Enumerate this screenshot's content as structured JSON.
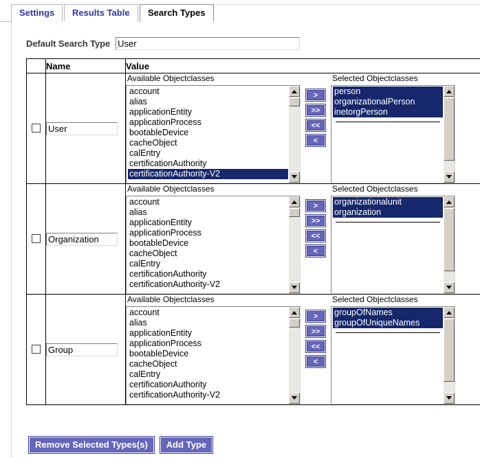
{
  "tabs": [
    {
      "label": "Settings",
      "active": false
    },
    {
      "label": "Results Table",
      "active": false
    },
    {
      "label": "Search Types",
      "active": true
    }
  ],
  "default_search_type": {
    "label": "Default Search Type",
    "value": "User",
    "placeholder": ""
  },
  "table": {
    "headers": [
      "",
      "Name",
      "Value"
    ],
    "header_check": "",
    "header_name": "Name",
    "header_value": "Value"
  },
  "labels": {
    "available": "Available Objectclasses",
    "selected": "Selected Objectclasses"
  },
  "arrow_buttons": [
    {
      "label": ">",
      "name": "move-right-button"
    },
    {
      "label": ">>",
      "name": "move-all-right-button"
    },
    {
      "label": "<<",
      "name": "move-all-left-button"
    },
    {
      "label": "<",
      "name": "move-left-button"
    }
  ],
  "available_objectclasses": [
    "account",
    "alias",
    "applicationEntity",
    "applicationProcess",
    "bootableDevice",
    "cacheObject",
    "calEntry",
    "certificationAuthority",
    "certificationAuthority-V2"
  ],
  "rows": [
    {
      "checked": false,
      "name": "User",
      "available_selected_index": 8,
      "selected_objectclasses": [
        "person",
        "organizationalPerson",
        "inetorgPerson"
      ]
    },
    {
      "checked": false,
      "name": "Organization",
      "available_selected_index": -1,
      "selected_objectclasses": [
        "organizationalunit",
        "organization"
      ]
    },
    {
      "checked": false,
      "name": "Group",
      "available_selected_index": -1,
      "selected_objectclasses": [
        "groupOfNames",
        "groupOfUniqueNames"
      ]
    }
  ],
  "footer": {
    "remove_label": "Remove Selected Types(s)",
    "add_label": "Add Type"
  },
  "colors": {
    "accent_button": "#6666bb",
    "accent_button_border": "#3a3a8a",
    "selection_blue": "#16286b",
    "tab_inactive_text": "#3333aa",
    "label_gray": "#3a3a3a"
  }
}
